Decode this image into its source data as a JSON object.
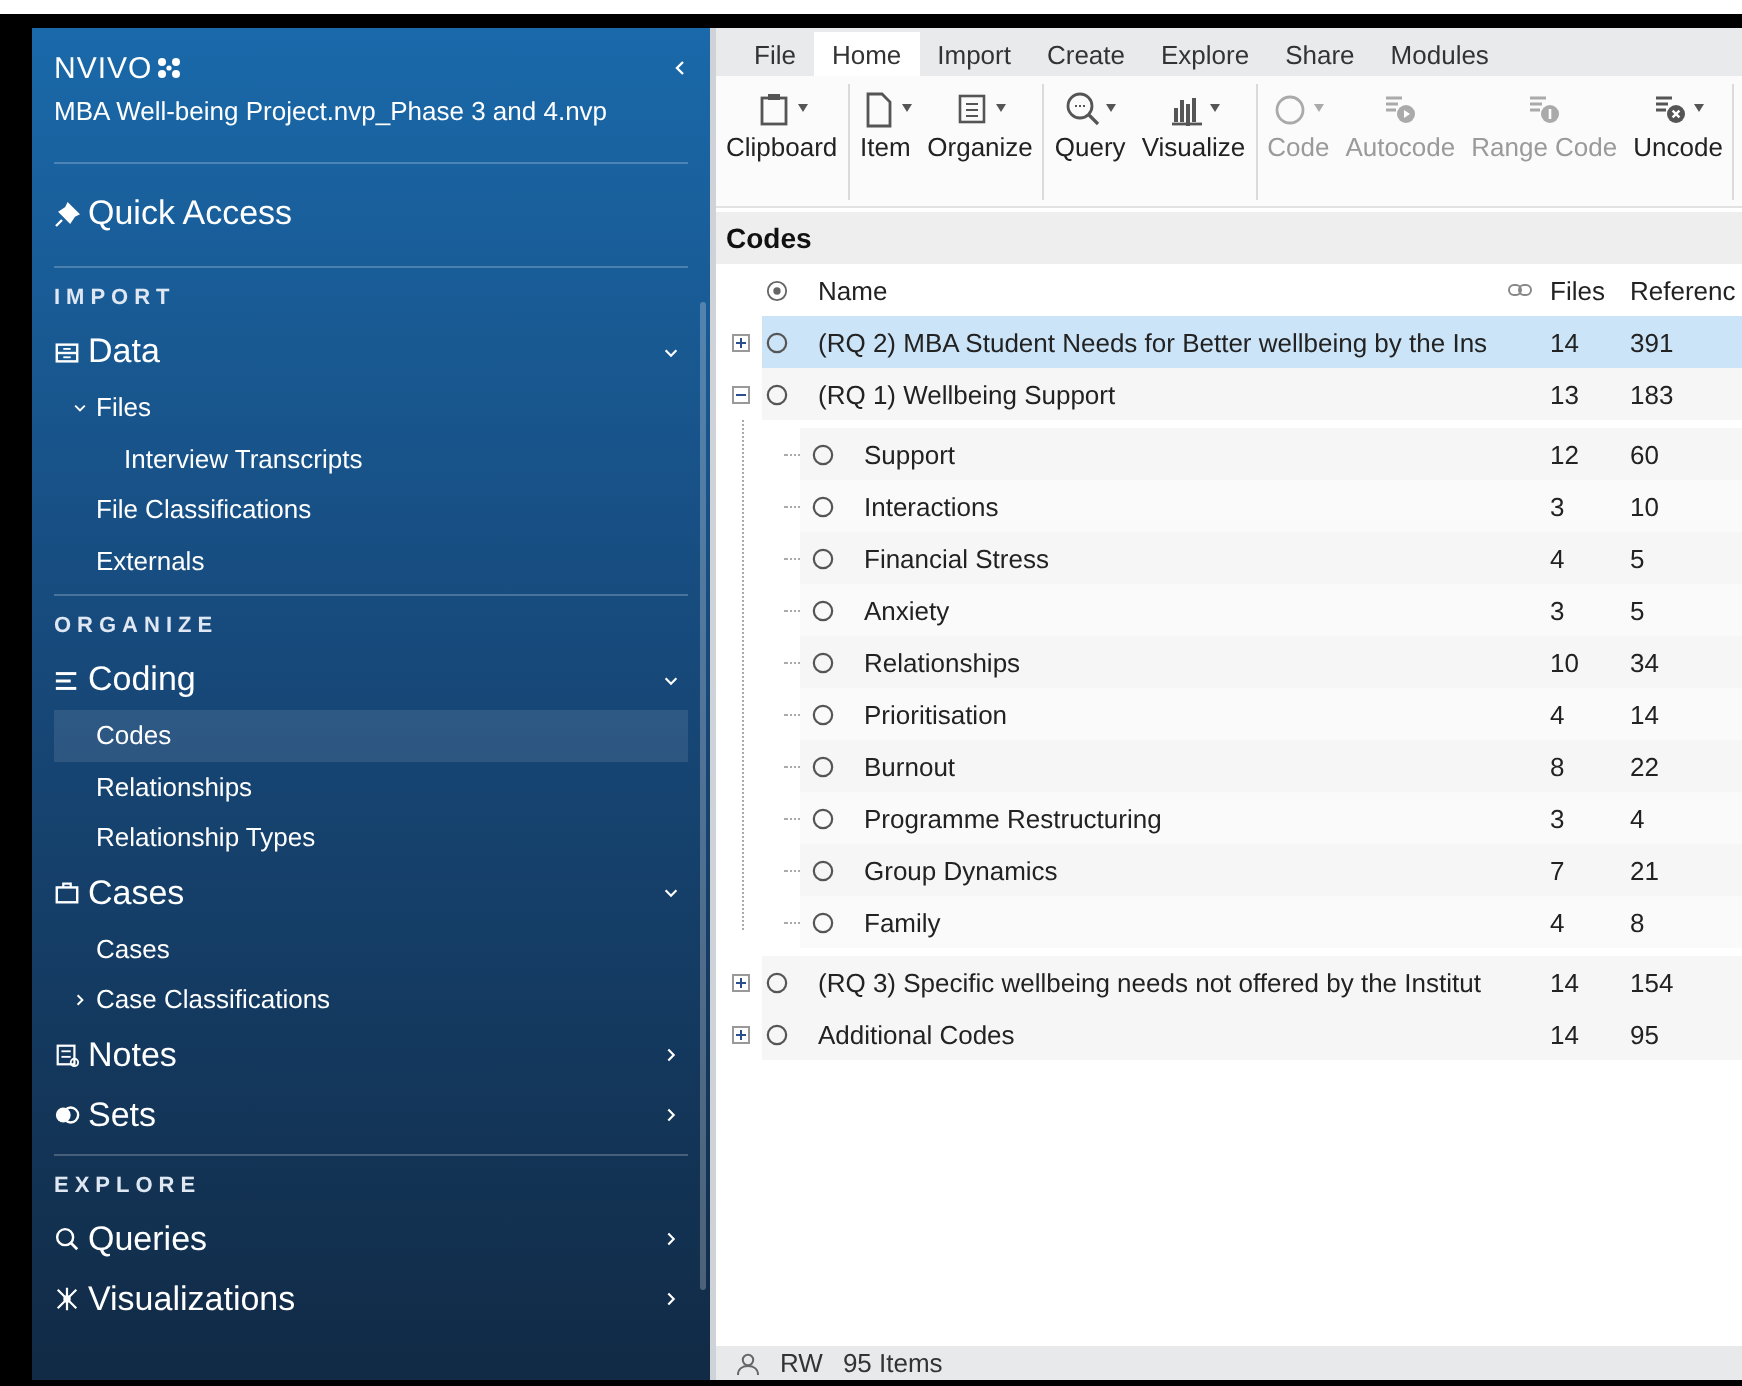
{
  "sidebar": {
    "logo": "NVIVO",
    "project": "MBA Well-being Project.nvp_Phase 3 and 4.nvp",
    "quick_access": "Quick Access",
    "sections": [
      {
        "heading": "IMPORT",
        "groups": [
          {
            "label": "Data",
            "kind": "data",
            "expanded": true,
            "items": [
              {
                "label": "Files",
                "selected": false,
                "expanded": true,
                "children": [
                  {
                    "label": "Interview Transcripts",
                    "selected": false
                  }
                ]
              },
              {
                "label": "File Classifications",
                "selected": false
              },
              {
                "label": "Externals",
                "selected": false
              }
            ]
          }
        ]
      },
      {
        "heading": "ORGANIZE",
        "groups": [
          {
            "label": "Coding",
            "kind": "coding",
            "expanded": true,
            "items": [
              {
                "label": "Codes",
                "selected": true
              },
              {
                "label": "Relationships",
                "selected": false
              },
              {
                "label": "Relationship Types",
                "selected": false
              }
            ]
          },
          {
            "label": "Cases",
            "kind": "cases",
            "expanded": true,
            "items": [
              {
                "label": "Cases",
                "selected": false
              },
              {
                "label": "Case Classifications",
                "selected": false,
                "expanded": false
              }
            ]
          },
          {
            "label": "Notes",
            "kind": "notes",
            "expanded": false
          },
          {
            "label": "Sets",
            "kind": "sets",
            "expanded": false
          }
        ]
      },
      {
        "heading": "EXPLORE",
        "groups": [
          {
            "label": "Queries",
            "kind": "queries",
            "expanded": false
          },
          {
            "label": "Visualizations",
            "kind": "visualizations",
            "expanded": false
          }
        ]
      }
    ]
  },
  "ribbon": {
    "tabs": [
      {
        "label": "File",
        "selected": false
      },
      {
        "label": "Home",
        "selected": true
      },
      {
        "label": "Import",
        "selected": false
      },
      {
        "label": "Create",
        "selected": false
      },
      {
        "label": "Explore",
        "selected": false
      },
      {
        "label": "Share",
        "selected": false
      },
      {
        "label": "Modules",
        "selected": false
      }
    ],
    "groups": [
      [
        {
          "label": "Clipboard",
          "kind": "clipboard",
          "dropdown": true,
          "disabled": false
        }
      ],
      [
        {
          "label": "Item",
          "kind": "item",
          "dropdown": true,
          "disabled": false
        },
        {
          "label": "Organize",
          "kind": "organize",
          "dropdown": true,
          "disabled": false
        }
      ],
      [
        {
          "label": "Query",
          "kind": "query",
          "dropdown": true,
          "disabled": false
        },
        {
          "label": "Visualize",
          "kind": "visualize",
          "dropdown": true,
          "disabled": false
        }
      ],
      [
        {
          "label": "Code",
          "kind": "code",
          "dropdown": true,
          "disabled": true
        },
        {
          "label": "Autocode",
          "kind": "autocode",
          "dropdown": false,
          "disabled": true
        },
        {
          "label": "Range Code",
          "kind": "rangecode",
          "dropdown": false,
          "disabled": true
        },
        {
          "label": "Uncode",
          "kind": "uncode",
          "dropdown": true,
          "disabled": false
        }
      ]
    ]
  },
  "codes": {
    "title": "Codes",
    "columns": [
      "Name",
      "Files",
      "Referenc"
    ],
    "rows": [
      {
        "name": "(RQ 2) MBA Student Needs for Better wellbeing by the Ins",
        "files": "14",
        "references": "391",
        "selected": true,
        "expanded": false
      },
      {
        "name": "(RQ 1) Wellbeing Support",
        "files": "13",
        "references": "183",
        "selected": false,
        "expanded": true,
        "children": [
          {
            "name": "Support",
            "files": "12",
            "references": "60",
            "selected": false
          },
          {
            "name": "Interactions",
            "files": "3",
            "references": "10",
            "selected": false
          },
          {
            "name": "Financial Stress",
            "files": "4",
            "references": "5",
            "selected": false
          },
          {
            "name": "Anxiety",
            "files": "3",
            "references": "5",
            "selected": false
          },
          {
            "name": "Relationships",
            "files": "10",
            "references": "34",
            "selected": false
          },
          {
            "name": "Prioritisation",
            "files": "4",
            "references": "14",
            "selected": false
          },
          {
            "name": "Burnout",
            "files": "8",
            "references": "22",
            "selected": false
          },
          {
            "name": "Programme Restructuring",
            "files": "3",
            "references": "4",
            "selected": false
          },
          {
            "name": "Group Dynamics",
            "files": "7",
            "references": "21",
            "selected": false
          },
          {
            "name": "Family",
            "files": "4",
            "references": "8",
            "selected": false
          }
        ]
      },
      {
        "name": "(RQ 3) Specific wellbeing needs not offered by the Institut",
        "files": "14",
        "references": "154",
        "selected": false,
        "expanded": false
      },
      {
        "name": "Additional Codes",
        "files": "14",
        "references": "95",
        "selected": false,
        "expanded": false
      }
    ]
  },
  "status_bar": {
    "user": "RW",
    "count": "95 Items"
  }
}
